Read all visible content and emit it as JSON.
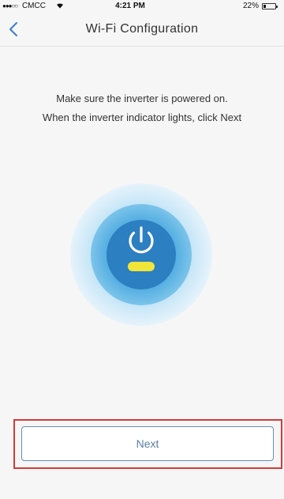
{
  "status_bar": {
    "signal": "●●●○○",
    "carrier": "CMCC",
    "time": "4:21 PM",
    "battery_percent": "22%",
    "battery_level": 0.22
  },
  "nav": {
    "back_icon": "chevron-left-icon",
    "title": "Wi-Fi Configuration"
  },
  "instructions": {
    "line1": "Make sure the inverter is powered on.",
    "line2": "When the inverter indicator lights, click Next"
  },
  "illustration": {
    "icon": "power-icon",
    "indicator": "indicator-light",
    "colors": {
      "outer_glow": "#cfe8f7",
      "middle_ring": "#5fb3e3",
      "inner_disc": "#2c7fc0",
      "power_symbol": "#ffffff",
      "indicator_light": "#f0e63a"
    }
  },
  "actions": {
    "next_label": "Next"
  },
  "colors": {
    "accent": "#5a7fa8",
    "highlight": "#d43a3a"
  }
}
